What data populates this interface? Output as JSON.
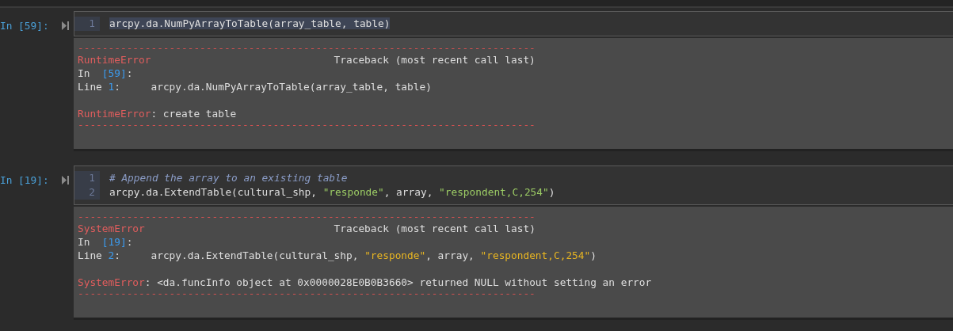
{
  "cells": [
    {
      "prompt": "In [59]:",
      "code": [
        {
          "number": "1",
          "highlighted": true,
          "tokens": [
            {
              "kind": "plain",
              "text": "arcpy.da.NumPyArrayToTable(array_table, table)"
            }
          ]
        }
      ],
      "output": [
        {
          "kind": "rule",
          "segments": [
            {
              "kind": "rule",
              "text": "---------------------------------------------------------------------------"
            }
          ]
        },
        {
          "kind": "text",
          "segments": [
            {
              "kind": "error",
              "text": "RuntimeError"
            },
            {
              "kind": "plain",
              "text": "                              Traceback (most recent call last)"
            }
          ]
        },
        {
          "kind": "text",
          "segments": [
            {
              "kind": "plain",
              "text": "In  "
            },
            {
              "kind": "number",
              "text": "[59]"
            },
            {
              "kind": "plain",
              "text": ":"
            }
          ]
        },
        {
          "kind": "text",
          "segments": [
            {
              "kind": "plain",
              "text": "Line "
            },
            {
              "kind": "number",
              "text": "1"
            },
            {
              "kind": "plain",
              "text": ":     arcpy.da.NumPyArrayToTable(array_table, table)"
            }
          ]
        },
        {
          "kind": "blank"
        },
        {
          "kind": "text",
          "segments": [
            {
              "kind": "error",
              "text": "RuntimeError"
            },
            {
              "kind": "plain",
              "text": ": create table"
            }
          ]
        },
        {
          "kind": "rule",
          "segments": [
            {
              "kind": "rule",
              "text": "---------------------------------------------------------------------------"
            }
          ]
        }
      ]
    },
    {
      "prompt": "In [19]:",
      "code": [
        {
          "number": "1",
          "highlighted": false,
          "tokens": [
            {
              "kind": "comment",
              "text": "# Append the array to an existing table"
            }
          ]
        },
        {
          "number": "2",
          "highlighted": false,
          "tokens": [
            {
              "kind": "plain",
              "text": "arcpy.da.ExtendTable(cultural_shp, "
            },
            {
              "kind": "string",
              "text": "\"responde\""
            },
            {
              "kind": "plain",
              "text": ", array, "
            },
            {
              "kind": "string",
              "text": "\"respondent,C,254\""
            },
            {
              "kind": "plain",
              "text": ")"
            }
          ]
        }
      ],
      "output": [
        {
          "kind": "rule",
          "segments": [
            {
              "kind": "rule",
              "text": "---------------------------------------------------------------------------"
            }
          ]
        },
        {
          "kind": "text",
          "segments": [
            {
              "kind": "error",
              "text": "SystemError"
            },
            {
              "kind": "plain",
              "text": "                               Traceback (most recent call last)"
            }
          ]
        },
        {
          "kind": "text",
          "segments": [
            {
              "kind": "plain",
              "text": "In  "
            },
            {
              "kind": "number",
              "text": "[19]"
            },
            {
              "kind": "plain",
              "text": ":"
            }
          ]
        },
        {
          "kind": "text",
          "segments": [
            {
              "kind": "plain",
              "text": "Line "
            },
            {
              "kind": "number",
              "text": "2"
            },
            {
              "kind": "plain",
              "text": ":     arcpy.da.ExtendTable(cultural_shp, "
            },
            {
              "kind": "ostring",
              "text": "\"responde\""
            },
            {
              "kind": "plain",
              "text": ", array, "
            },
            {
              "kind": "ostring",
              "text": "\"respondent,C,254\""
            },
            {
              "kind": "plain",
              "text": ")"
            }
          ]
        },
        {
          "kind": "blank"
        },
        {
          "kind": "text",
          "segments": [
            {
              "kind": "error",
              "text": "SystemError"
            },
            {
              "kind": "plain",
              "text": ": <da.funcInfo object at 0x0000028E0B0B3660> returned NULL without setting an error"
            }
          ]
        },
        {
          "kind": "rule",
          "segments": [
            {
              "kind": "rule",
              "text": "---------------------------------------------------------------------------"
            }
          ]
        }
      ]
    }
  ]
}
